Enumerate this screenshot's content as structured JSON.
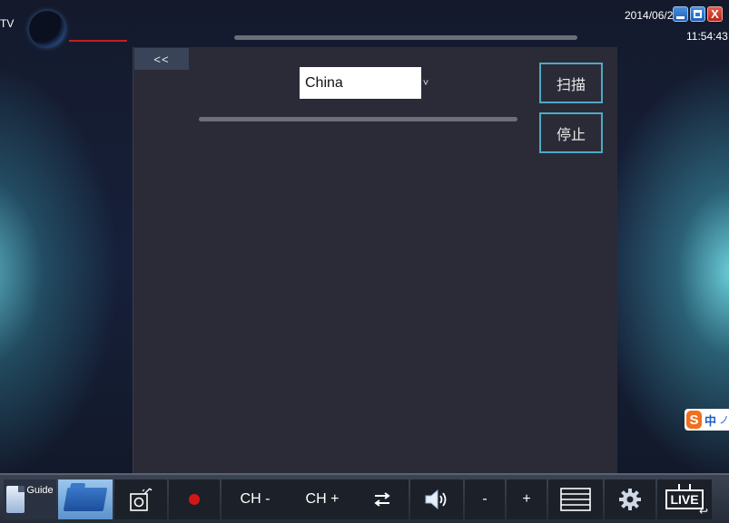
{
  "app": {
    "label": "TV"
  },
  "clock": {
    "date": "2014/06/27",
    "time": "11:54:43"
  },
  "window_controls": {
    "minimize": "minimize-icon",
    "maximize": "maximize-icon",
    "close": "close-icon",
    "close_glyph": "X"
  },
  "panel": {
    "back_label": "<<",
    "country_value": "China",
    "country_arrow": "˅",
    "scan_label": "扫描",
    "stop_label": "停止"
  },
  "ime": {
    "logo": "S",
    "mode": "中",
    "extra": "ノ"
  },
  "taskbar": {
    "guide_label": "Guide",
    "ch_minus_label": "CH -",
    "ch_plus_label": "CH +",
    "vol_minus_label": "-",
    "vol_plus_label": "+",
    "live_label": "LIVE",
    "live_arrow": "↩"
  },
  "colors": {
    "accent": "#4fa9c4",
    "record": "#d01818",
    "panel_bg": "#2b2b38"
  }
}
